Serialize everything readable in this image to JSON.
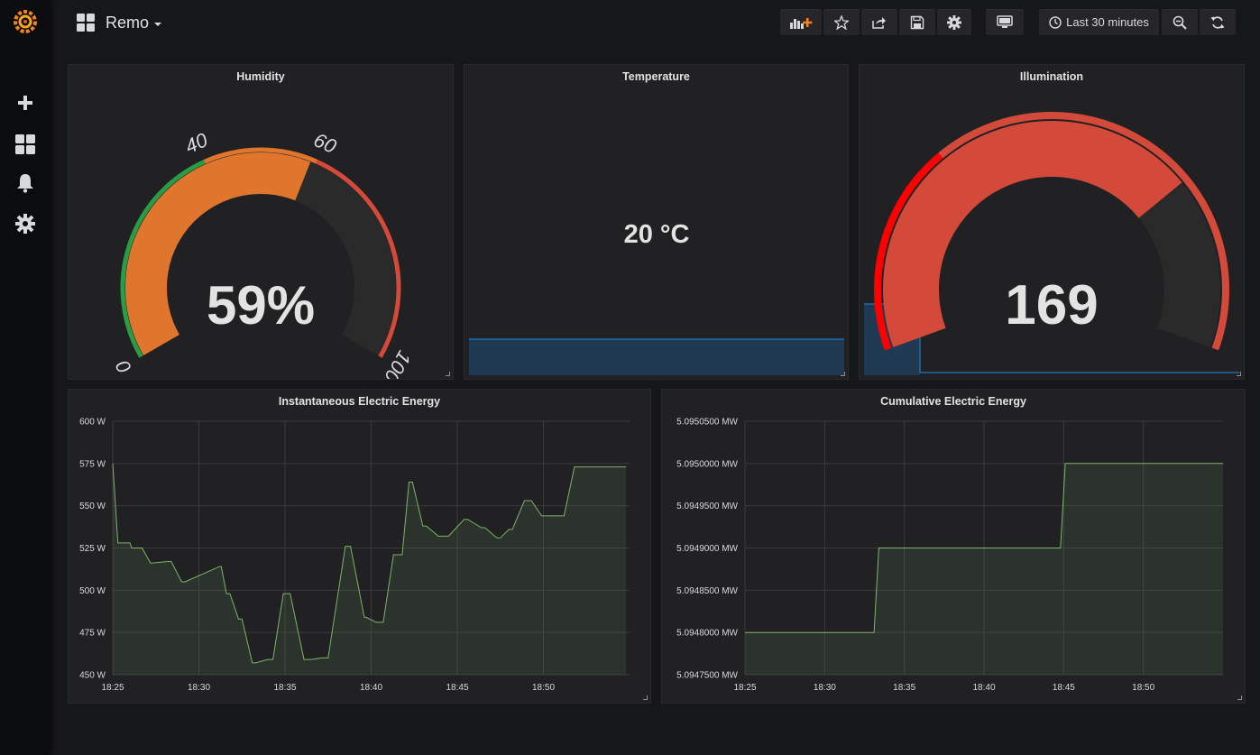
{
  "dashboard": {
    "title": "Remo"
  },
  "toolbar": {
    "time_range_label": "Last 30 minutes"
  },
  "sidebar": {
    "items": [
      {
        "icon": "grafana-logo-icon"
      },
      {
        "icon": "plus-icon"
      },
      {
        "icon": "dashboards-icon"
      },
      {
        "icon": "bell-icon"
      },
      {
        "icon": "gear-icon"
      }
    ]
  },
  "colors": {
    "green": "#299c46",
    "orange": "#e0752d",
    "red": "#d44a3a",
    "bright_red": "#ff0000",
    "series_green": "#7eb26d",
    "blue": "#1f78c1"
  },
  "panels": {
    "humidity": {
      "title": "Humidity",
      "value_text": "59%",
      "value": 59,
      "min": 0,
      "max": 100,
      "threshold_labels": [
        "0",
        "40",
        "60",
        "100"
      ],
      "thresholds": [
        40,
        60
      ]
    },
    "temperature": {
      "title": "Temperature",
      "value_text": "20 °C"
    },
    "illumination": {
      "title": "Illumination",
      "value_text": "169"
    },
    "instant_energy": {
      "title": "Instantaneous Electric Energy"
    },
    "cumulative_energy": {
      "title": "Cumulative Electric Energy"
    }
  },
  "chart_data": [
    {
      "type": "line",
      "title": "Instantaneous Electric Energy",
      "unit": "W",
      "xticks": [
        "18:25",
        "18:30",
        "18:35",
        "18:40",
        "18:45",
        "18:50"
      ],
      "yticks": [
        "450 W",
        "475 W",
        "500 W",
        "525 W",
        "550 W",
        "575 W",
        "600 W"
      ],
      "ylim": [
        450,
        600
      ],
      "xlim_minutes": [
        0,
        30
      ],
      "x_minutes": [
        0,
        0.3,
        1,
        1.1,
        1.7,
        2.2,
        3.2,
        3.4,
        4,
        4.2,
        6.2,
        6.3,
        6.6,
        6.8,
        7.3,
        7.5,
        8.1,
        8.3,
        9,
        9.3,
        9.9,
        10.3,
        11.1,
        11.5,
        12.2,
        12.5,
        13.5,
        13.8,
        14.6,
        14.7,
        15.3,
        15.7,
        16.3,
        16.8,
        17.2,
        17.4,
        18,
        18.2,
        18.9,
        19.5,
        20.4,
        20.6,
        21.4,
        21.6,
        22.3,
        22.5,
        23,
        23.2,
        23.9,
        24.3,
        24.9,
        25.2,
        25.9,
        26.2,
        26.8,
        27.1,
        28.8,
        29.1,
        29.8
      ],
      "y_values": [
        575,
        528,
        528,
        525,
        525,
        516,
        517,
        517,
        505,
        505,
        514,
        514,
        498,
        498,
        483,
        483,
        457,
        457,
        459,
        459,
        498,
        498,
        459,
        459,
        460,
        460,
        526,
        526,
        484,
        484,
        481,
        481,
        521,
        521,
        564,
        564,
        538,
        538,
        532,
        532,
        542,
        542,
        537,
        537,
        531,
        531,
        536,
        536,
        553,
        553,
        544,
        544,
        544,
        544,
        573,
        573,
        573,
        573,
        573
      ],
      "fill": true,
      "color": "#7eb26d"
    },
    {
      "type": "line",
      "title": "Cumulative Electric Energy",
      "unit": "MW",
      "xticks": [
        "18:25",
        "18:30",
        "18:35",
        "18:40",
        "18:45",
        "18:50"
      ],
      "yticks": [
        "5.0947500 MW",
        "5.0948000 MW",
        "5.0948500 MW",
        "5.0949000 MW",
        "5.0949500 MW",
        "5.0950000 MW",
        "5.0950500 MW"
      ],
      "ylim": [
        5.09475,
        5.09505
      ],
      "xlim_minutes": [
        0,
        30
      ],
      "x_minutes": [
        0,
        8.1,
        8.4,
        19.8,
        20.1,
        30
      ],
      "y_values": [
        5.0948,
        5.0948,
        5.0949,
        5.0949,
        5.095,
        5.095
      ],
      "fill": true,
      "color": "#7eb26d"
    }
  ]
}
